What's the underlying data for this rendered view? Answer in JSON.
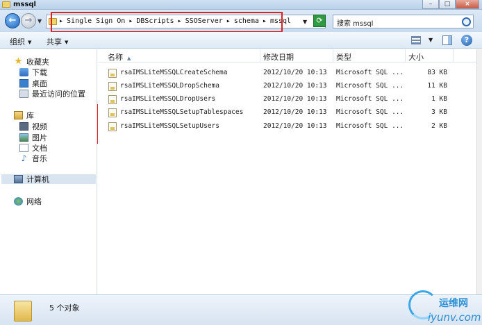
{
  "window": {
    "title": "mssql"
  },
  "nav_bar": {
    "breadcrumbs": [
      "Single Sign On",
      "DBScripts",
      "SSOServer",
      "schema",
      "mssql"
    ],
    "search_placeholder": "搜索 mssql"
  },
  "toolbar": {
    "organize": "组织",
    "share": "共享"
  },
  "sidebar": {
    "favorites": "收藏夹",
    "downloads": "下载",
    "desktop": "桌面",
    "recent": "最近访问的位置",
    "libraries": "库",
    "videos": "视频",
    "pictures": "图片",
    "documents": "文档",
    "music": "音乐",
    "computer": "计算机",
    "network": "网络"
  },
  "columns": {
    "name": "名称",
    "modified": "修改日期",
    "type": "类型",
    "size": "大小"
  },
  "files": [
    {
      "name": "rsaIMSLiteMSSQLCreateSchema",
      "modified": "2012/10/20 10:13",
      "type": "Microsoft SQL ...",
      "size": "83 KB"
    },
    {
      "name": "rsaIMSLiteMSSQLDropSchema",
      "modified": "2012/10/20 10:13",
      "type": "Microsoft SQL ...",
      "size": "11 KB"
    },
    {
      "name": "rsaIMSLiteMSSQLDropUsers",
      "modified": "2012/10/20 10:13",
      "type": "Microsoft SQL ...",
      "size": "1 KB"
    },
    {
      "name": "rsaIMSLiteMSSQLSetupTablespaces",
      "modified": "2012/10/20 10:13",
      "type": "Microsoft SQL ...",
      "size": "3 KB"
    },
    {
      "name": "rsaIMSLiteMSSQLSetupUsers",
      "modified": "2012/10/20 10:13",
      "type": "Microsoft SQL ...",
      "size": "2 KB"
    }
  ],
  "status": {
    "count": "5 个对象"
  },
  "watermark": {
    "line1": "运维网",
    "line2": "iyunv.com"
  },
  "colors": {
    "highlight_box": "#e02020",
    "selected_nav": "#d9e4f1"
  }
}
